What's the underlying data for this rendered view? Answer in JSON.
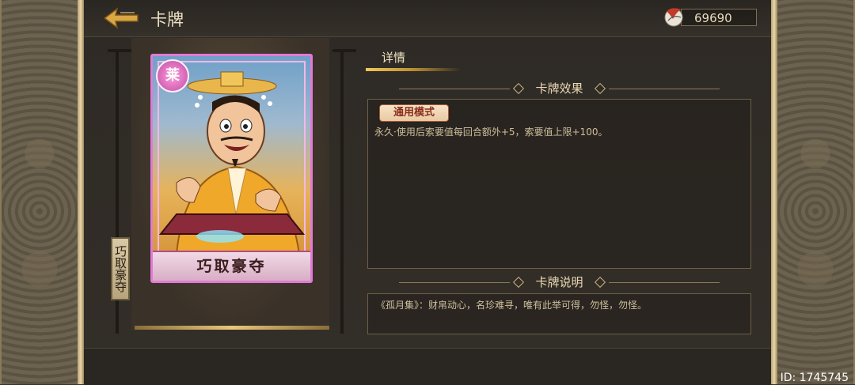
{
  "header": {
    "title": "卡牌",
    "currency_value": "69690",
    "back_icon": "back-arrow-icon",
    "currency_icon": "feather-token-icon"
  },
  "card": {
    "name": "巧取豪夺",
    "badge": "莱",
    "vertical_label": "巧取豪夺"
  },
  "detail": {
    "tab_label": "详情",
    "effect_section_title": "卡牌效果",
    "mode_tag": "通用模式",
    "effect_text": "永久·使用后索要值每回合额外+5，索要值上限+100。",
    "desc_section_title": "卡牌说明",
    "desc_text": "《孤月集》：财帛动心，名珍难寻，唯有此举可得，勿怪，勿怪。"
  },
  "footer": {
    "id_text": "ID: 1745745"
  },
  "colors": {
    "accent_gold": "#f0c85a",
    "card_border": "#e07ad6",
    "text_light": "#efe3c4"
  }
}
